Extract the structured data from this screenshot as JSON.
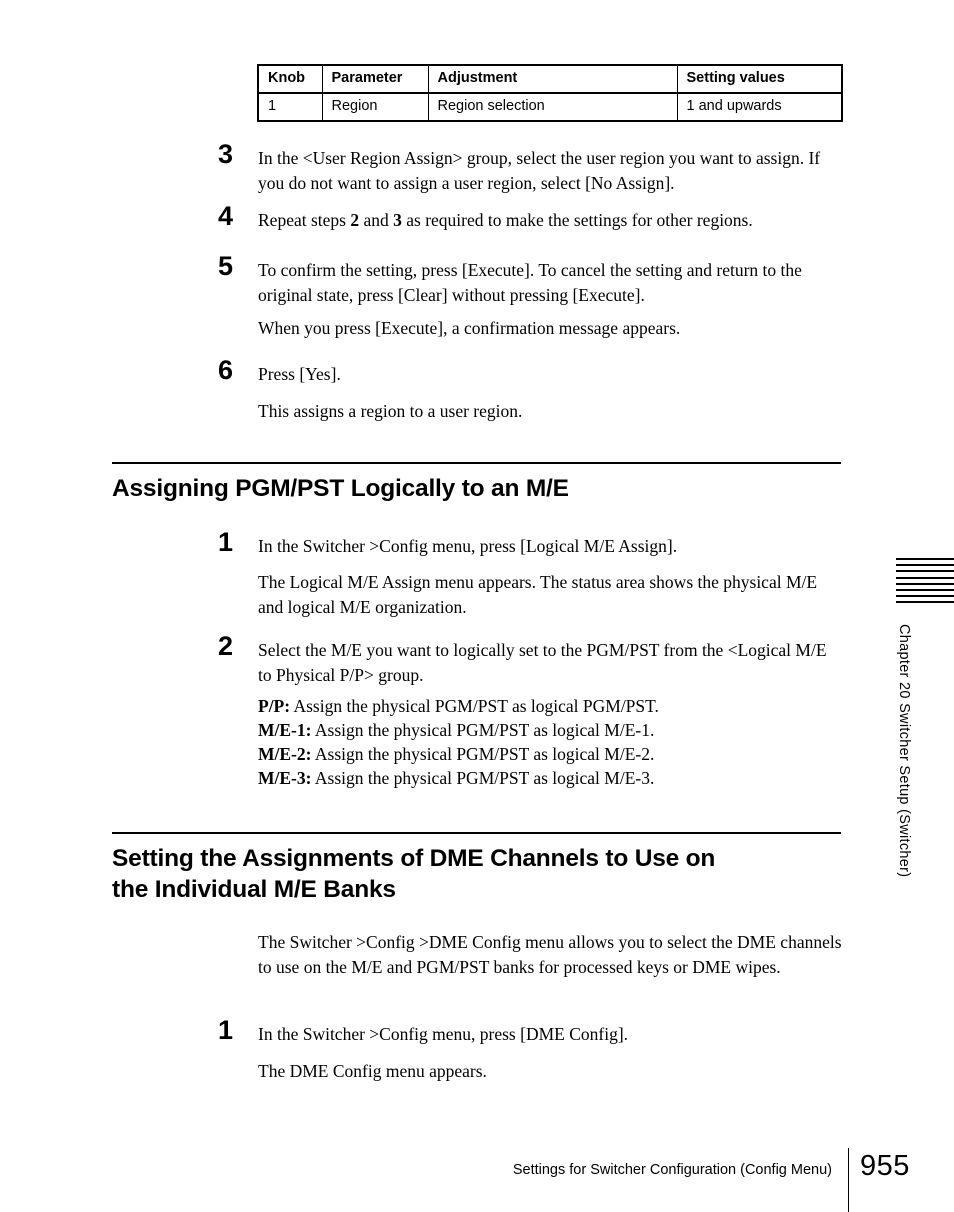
{
  "table": {
    "columns": [
      "Knob",
      "Parameter",
      "Adjustment",
      "Setting values"
    ],
    "rows": [
      [
        "1",
        "Region",
        "Region selection",
        "1 and upwards"
      ]
    ]
  },
  "steps_top": [
    {
      "num": "3",
      "text": "In the <User Region Assign> group, select the user region you want to assign. If you do not want to assign a user region, select [No Assign]."
    },
    {
      "num": "4",
      "text_pre": "Repeat steps ",
      "bold_a": "2",
      "text_mid": " and ",
      "bold_b": "3",
      "text_post": " as required to make the settings for other regions."
    },
    {
      "num": "5",
      "text": "To confirm the setting, press [Execute]. To cancel the setting and return to the original state, press [Clear] without pressing [Execute]."
    },
    {
      "num": "6",
      "text": "Press [Yes]."
    }
  ],
  "paragraphs_top": {
    "after_step5": "When you press [Execute], a confirmation message appears.",
    "after_step6": "This assigns a region to a user region."
  },
  "section_one": {
    "heading": "Assigning PGM/PST Logically to an M/E",
    "step1_num": "1",
    "step1_text": "In the Switcher >Config menu, press [Logical M/E Assign].",
    "step1_note": "The Logical M/E Assign menu appears. The status area shows the physical M/E and logical M/E organization.",
    "step2_num": "2",
    "step2_text": "Select the M/E you want to logically set to the PGM/PST from the <Logical M/E to Physical P/P> group.",
    "definitions": [
      {
        "term": "P/P:",
        "desc": " Assign the physical PGM/PST as logical PGM/PST."
      },
      {
        "term": "M/E-1:",
        "desc": " Assign the physical PGM/PST as logical M/E-1."
      },
      {
        "term": "M/E-2:",
        "desc": " Assign the physical PGM/PST as logical M/E-2."
      },
      {
        "term": "M/E-3:",
        "desc": " Assign the physical PGM/PST as logical M/E-3."
      }
    ]
  },
  "section_two": {
    "heading_line1": "Setting the Assignments of DME Channels to Use on",
    "heading_line2": "the Individual M/E Banks",
    "intro": "The Switcher >Config >DME Config menu allows you to select the DME channels to use on the M/E and PGM/PST banks for processed keys or DME wipes.",
    "step1_num": "1",
    "step1_text": "In the Switcher >Config menu, press [DME Config].",
    "step1_note": "The DME Config menu appears."
  },
  "chapter_tab": {
    "text": "Chapter 20   Switcher Setup (Switcher)",
    "stripe_count": 8
  },
  "footer": {
    "text": "Settings for Switcher Configuration (Config Menu)",
    "page": "955"
  }
}
